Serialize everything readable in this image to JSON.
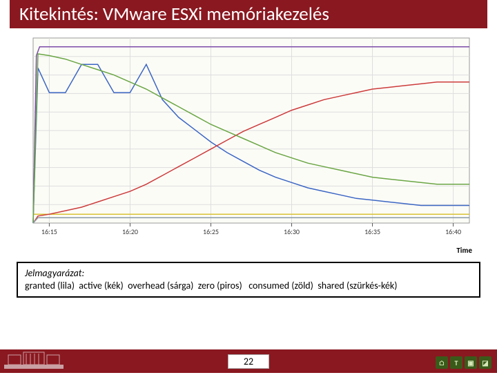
{
  "title": "Kitekintés: VMware ESXi memóriakezelés",
  "chart_xaxis_label": "Time",
  "legend": {
    "heading": "Jelmagyarázat:",
    "line": "granted (lila)  active (kék)  overhead (sárga)  zero (piros)   consumed (zöld)  shared (szürkés-kék)"
  },
  "footer": {
    "page": "22"
  },
  "chart_data": {
    "type": "line",
    "title": "",
    "xlabel": "Time",
    "ylabel": "",
    "x_ticks": [
      "16:15",
      "16:20",
      "16:25",
      "16:30",
      "16:35",
      "16:40"
    ],
    "xlim": [
      "16:14",
      "16:41"
    ],
    "ylim": [
      0,
      105
    ],
    "grid": true,
    "series": [
      {
        "name": "granted (lila)",
        "color": "#7b4aa8",
        "x": [
          "16:14.0",
          "16:14.2",
          "16:14.4",
          "16:15",
          "16:20",
          "16:25",
          "16:30",
          "16:35",
          "16:40",
          "16:41"
        ],
        "y": [
          0,
          95,
          100,
          100,
          100,
          100,
          100,
          100,
          100,
          100
        ]
      },
      {
        "name": "active (kék)",
        "color": "#3b66c4",
        "x": [
          "16:14.0",
          "16:14.3",
          "16:15",
          "16:16",
          "16:17",
          "16:18",
          "16:19",
          "16:20",
          "16:21",
          "16:22",
          "16:23",
          "16:24",
          "16:25",
          "16:26",
          "16:27",
          "16:28",
          "16:29",
          "16:30",
          "16:31",
          "16:32",
          "16:33",
          "16:34",
          "16:35",
          "16:36",
          "16:37",
          "16:38",
          "16:40",
          "16:41"
        ],
        "y": [
          0,
          88,
          74,
          74,
          90,
          90,
          74,
          74,
          90,
          70,
          60,
          53,
          46,
          40,
          35,
          30,
          26,
          23,
          20,
          18,
          16,
          14,
          13,
          12,
          11,
          10,
          10,
          10
        ]
      },
      {
        "name": "overhead (sárga)",
        "color": "#d8c233",
        "x": [
          "16:14",
          "16:41"
        ],
        "y": [
          5,
          5
        ]
      },
      {
        "name": "zero (piros)",
        "color": "#cc3b3b",
        "x": [
          "16:14.0",
          "16:14.3",
          "16:15",
          "16:16",
          "16:17",
          "16:18",
          "16:19",
          "16:20",
          "16:21",
          "16:22",
          "16:23",
          "16:24",
          "16:25",
          "16:26",
          "16:27",
          "16:28",
          "16:29",
          "16:30",
          "16:31",
          "16:32",
          "16:33",
          "16:34",
          "16:35",
          "16:36",
          "16:37",
          "16:38",
          "16:39",
          "16:40",
          "16:41"
        ],
        "y": [
          0,
          4,
          5,
          7,
          9,
          12,
          15,
          18,
          22,
          27,
          32,
          37,
          42,
          47,
          52,
          56,
          60,
          64,
          67,
          70,
          72,
          74,
          76,
          77,
          78,
          79,
          80,
          80,
          80
        ]
      },
      {
        "name": "consumed (zöld)",
        "color": "#6aa644",
        "x": [
          "16:14.0",
          "16:14.3",
          "16:15",
          "16:16",
          "16:17",
          "16:18",
          "16:19",
          "16:20",
          "16:21",
          "16:22",
          "16:23",
          "16:24",
          "16:25",
          "16:26",
          "16:27",
          "16:28",
          "16:29",
          "16:30",
          "16:31",
          "16:32",
          "16:33",
          "16:34",
          "16:35",
          "16:36",
          "16:37",
          "16:38",
          "16:39",
          "16:40",
          "16:41"
        ],
        "y": [
          0,
          96,
          95,
          93,
          90,
          87,
          84,
          80,
          76,
          71,
          66,
          61,
          56,
          52,
          48,
          44,
          40,
          37,
          34,
          32,
          30,
          28,
          26,
          25,
          24,
          23,
          22,
          22,
          22
        ]
      },
      {
        "name": "shared (szürkés-kék)",
        "color": "#8a9aa6",
        "x": [
          "16:14.0",
          "16:14.3",
          "16:15",
          "16:41"
        ],
        "y": [
          0,
          3,
          3,
          3
        ]
      }
    ]
  }
}
